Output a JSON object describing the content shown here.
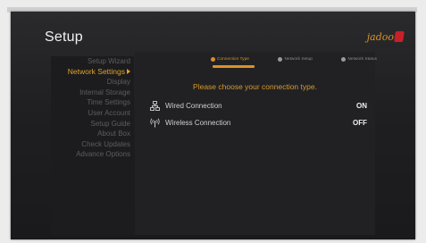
{
  "app": {
    "title": "Setup",
    "logo_text": "jadoo"
  },
  "sidebar": {
    "items": [
      {
        "label": "Setup Wizard",
        "active": false
      },
      {
        "label": "Network Settings",
        "active": true
      },
      {
        "label": "Display",
        "active": false
      },
      {
        "label": "Internal Storage",
        "active": false
      },
      {
        "label": "Time Settings",
        "active": false
      },
      {
        "label": "User Account",
        "active": false
      },
      {
        "label": "Setup Guide",
        "active": false
      },
      {
        "label": "About Box",
        "active": false
      },
      {
        "label": "Check Updates",
        "active": false
      },
      {
        "label": "Advance Options",
        "active": false
      }
    ]
  },
  "steps": [
    {
      "label": "Connection Type",
      "active": true
    },
    {
      "label": "Network Setup",
      "active": false
    },
    {
      "label": "Network Status",
      "active": false
    }
  ],
  "main": {
    "prompt": "Please choose your connection type.",
    "connections": [
      {
        "label": "Wired Connection",
        "value": "ON",
        "icon": "network-icon"
      },
      {
        "label": "Wireless Connection",
        "value": "OFF",
        "icon": "wifi-icon"
      }
    ]
  },
  "colors": {
    "accent": "#e0a127",
    "logo_red": "#c8202a",
    "background": "#1f1f21"
  }
}
